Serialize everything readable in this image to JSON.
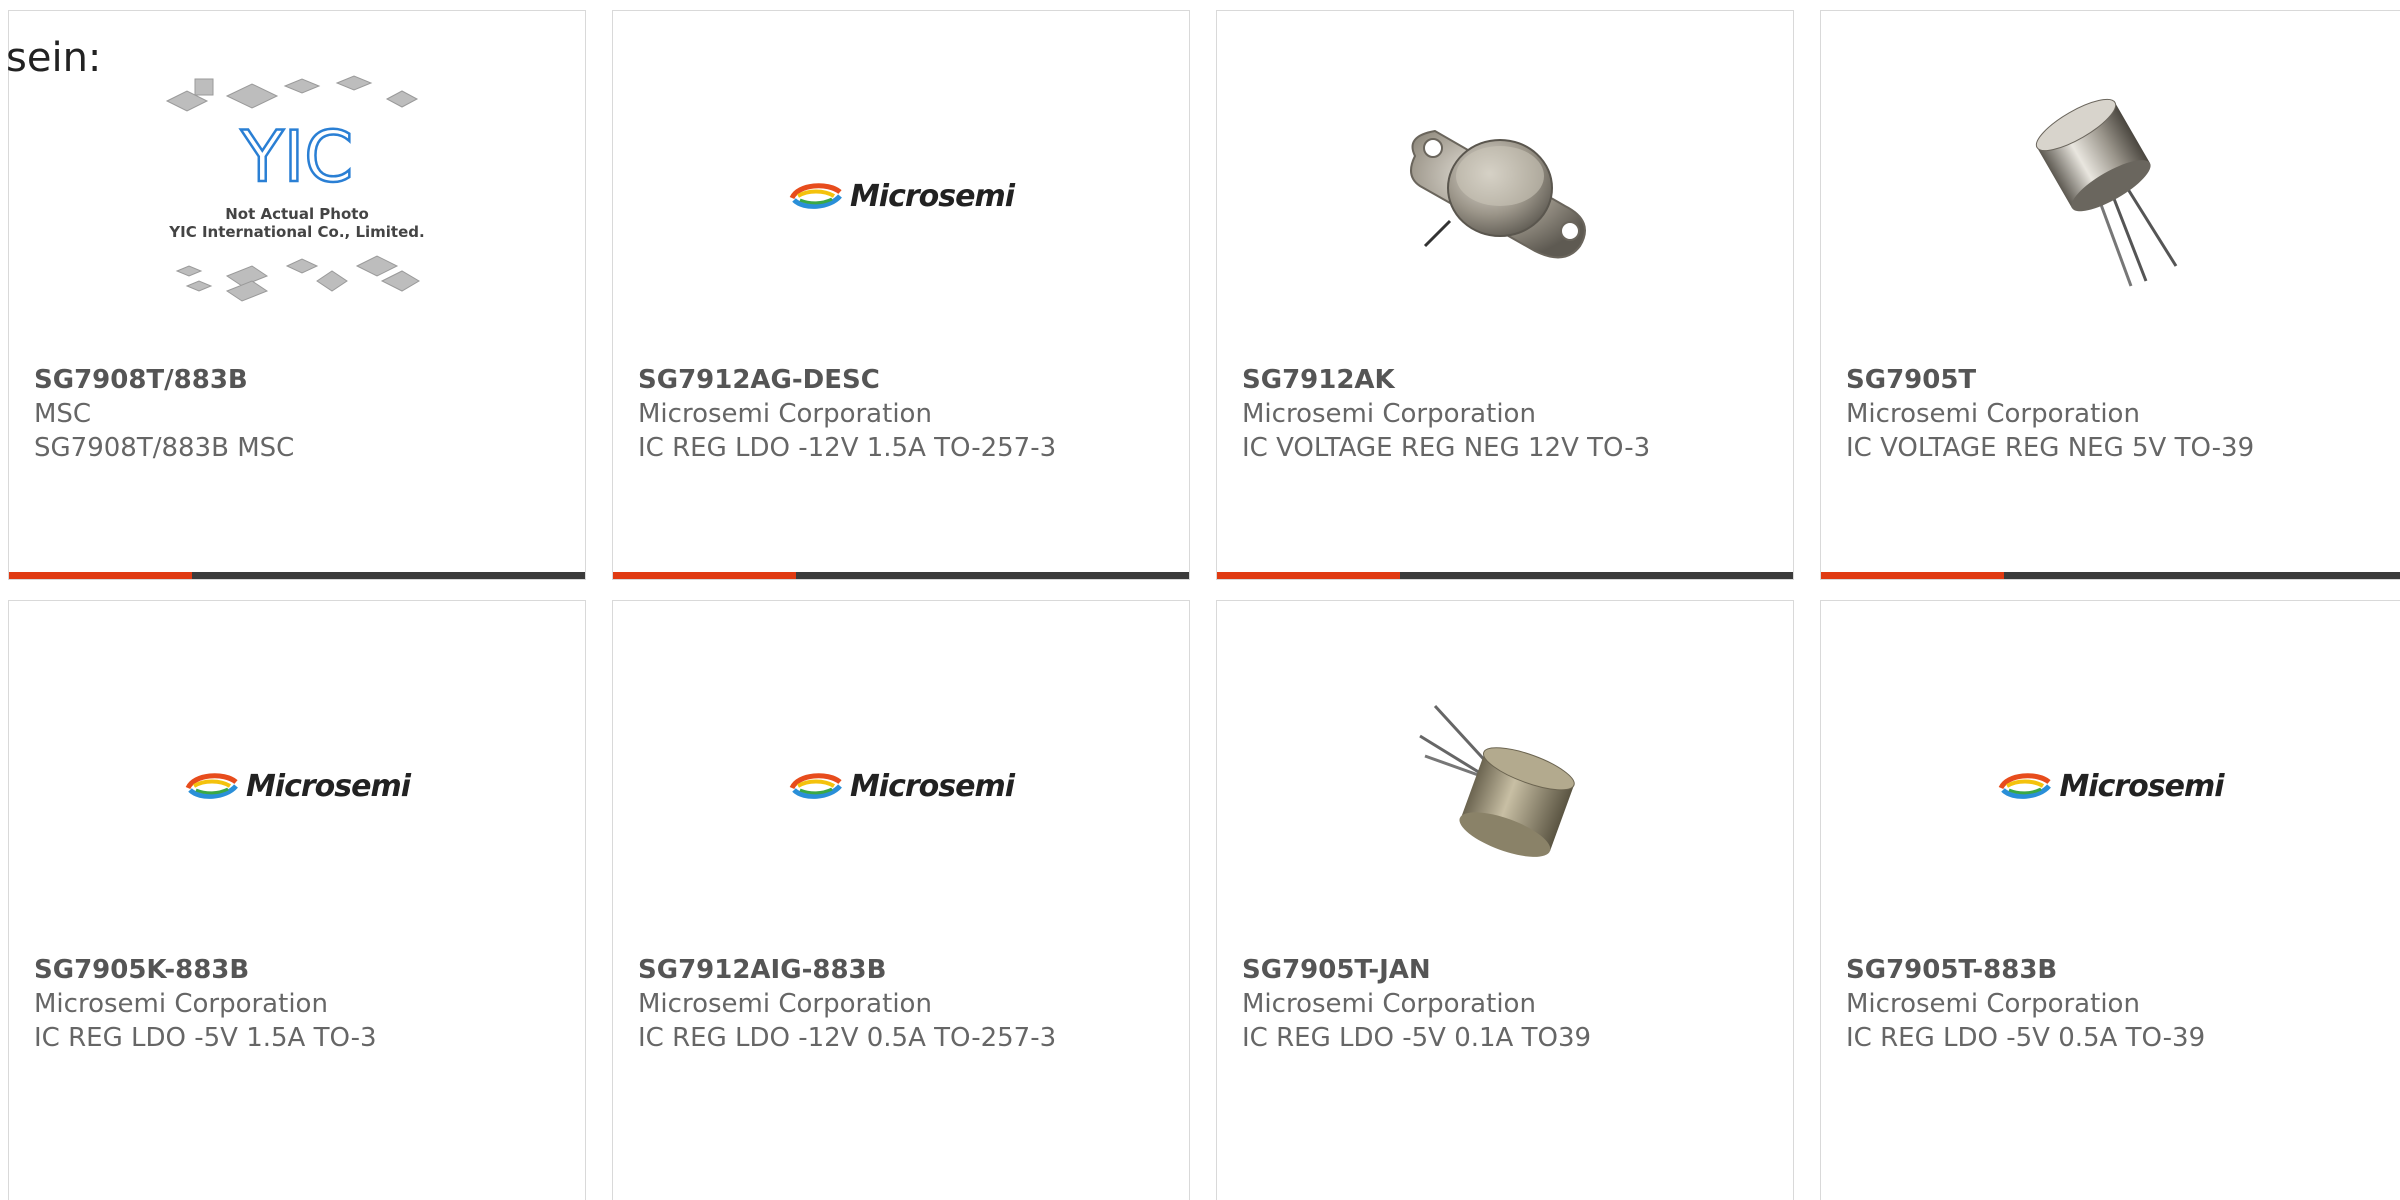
{
  "heading": "sein:",
  "colors": {
    "accent": "#e03a12",
    "bar": "#3b3b3b",
    "text": "#666666"
  },
  "placeholder_caption": {
    "line1": "Not Actual Photo",
    "line2": "YIC International Co., Limited."
  },
  "brand_logo_text": "Microsemi",
  "yic_logo_text": "YIC",
  "products": [
    {
      "part": "SG7908T/883B",
      "maker": "MSC",
      "desc": "SG7908T/883B MSC",
      "image": "yic-placeholder"
    },
    {
      "part": "SG7912AG-DESC",
      "maker": "Microsemi Corporation",
      "desc": "IC REG LDO -12V 1.5A TO-257-3",
      "image": "microsemi-logo"
    },
    {
      "part": "SG7912AK",
      "maker": "Microsemi Corporation",
      "desc": "IC VOLTAGE REG NEG 12V TO-3",
      "image": "to3-package"
    },
    {
      "part": "SG7905T",
      "maker": "Microsemi Corporation",
      "desc": "IC VOLTAGE REG NEG 5V TO-39",
      "image": "to39-package"
    },
    {
      "part": "SG7905K-883B",
      "maker": "Microsemi Corporation",
      "desc": "IC REG LDO -5V 1.5A TO-3",
      "image": "microsemi-logo"
    },
    {
      "part": "SG7912AIG-883B",
      "maker": "Microsemi Corporation",
      "desc": "IC REG LDO -12V 0.5A TO-257-3",
      "image": "microsemi-logo"
    },
    {
      "part": "SG7905T-JAN",
      "maker": "Microsemi Corporation",
      "desc": "IC REG LDO -5V 0.1A TO39",
      "image": "to39-package-gold"
    },
    {
      "part": "SG7905T-883B",
      "maker": "Microsemi Corporation",
      "desc": "IC REG LDO -5V 0.5A TO-39",
      "image": "microsemi-logo"
    }
  ]
}
